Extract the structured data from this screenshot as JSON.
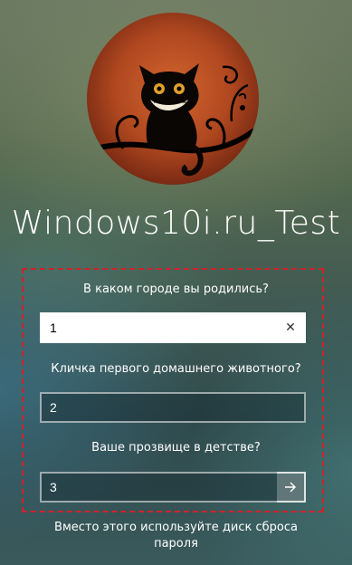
{
  "user": {
    "name": "Windows10i.ru_Test"
  },
  "security_questions": [
    {
      "question": "В каком городе вы родились?",
      "answer": "1"
    },
    {
      "question": "Кличка первого домашнего животного?",
      "answer": "2"
    },
    {
      "question": "Ваше прозвище в детстве?",
      "answer": "3"
    }
  ],
  "reset_link": {
    "line1": "Вместо этого используйте диск сброса",
    "line2": "пароля"
  },
  "icons": {
    "clear": "close-icon",
    "submit": "arrow-right-icon",
    "avatar": "cheshire-cat-image"
  },
  "colors": {
    "highlight_border": "#d1222a"
  }
}
